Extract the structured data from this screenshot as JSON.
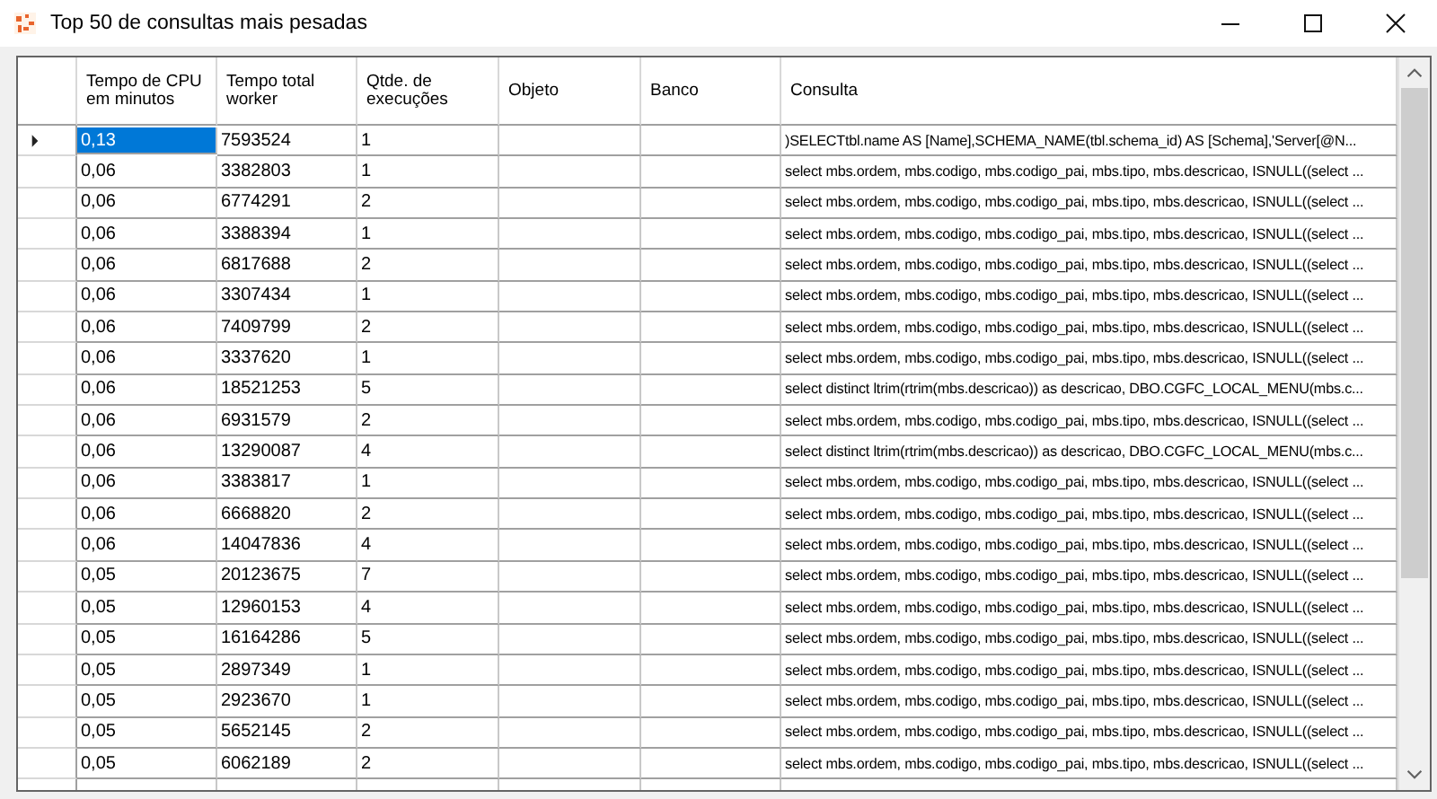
{
  "window": {
    "title": "Top 50 de consultas mais pesadas"
  },
  "table": {
    "columns": [
      "Tempo de CPU em minutos",
      "Tempo total worker",
      "Qtde. de execuções",
      "Objeto",
      "Banco",
      "Consulta"
    ],
    "rows": [
      {
        "selected": true,
        "cells": [
          "0,13",
          "7593524",
          "1",
          "",
          "",
          ")SELECTtbl.name AS [Name],SCHEMA_NAME(tbl.schema_id) AS [Schema],'Server[@N..."
        ]
      },
      {
        "selected": false,
        "cells": [
          "0,06",
          "3382803",
          "1",
          "",
          "",
          "select mbs.ordem, mbs.codigo, mbs.codigo_pai, mbs.tipo, mbs.descricao, ISNULL((select ..."
        ]
      },
      {
        "selected": false,
        "cells": [
          "0,06",
          "6774291",
          "2",
          "",
          "",
          "select mbs.ordem, mbs.codigo, mbs.codigo_pai, mbs.tipo, mbs.descricao, ISNULL((select ..."
        ]
      },
      {
        "selected": false,
        "cells": [
          "0,06",
          "3388394",
          "1",
          "",
          "",
          "select mbs.ordem, mbs.codigo, mbs.codigo_pai, mbs.tipo, mbs.descricao, ISNULL((select ..."
        ]
      },
      {
        "selected": false,
        "cells": [
          "0,06",
          "6817688",
          "2",
          "",
          "",
          "select mbs.ordem, mbs.codigo, mbs.codigo_pai, mbs.tipo, mbs.descricao, ISNULL((select ..."
        ]
      },
      {
        "selected": false,
        "cells": [
          "0,06",
          "3307434",
          "1",
          "",
          "",
          "select mbs.ordem, mbs.codigo, mbs.codigo_pai, mbs.tipo, mbs.descricao, ISNULL((select ..."
        ]
      },
      {
        "selected": false,
        "cells": [
          "0,06",
          "7409799",
          "2",
          "",
          "",
          "select mbs.ordem, mbs.codigo, mbs.codigo_pai, mbs.tipo, mbs.descricao, ISNULL((select ..."
        ]
      },
      {
        "selected": false,
        "cells": [
          "0,06",
          "3337620",
          "1",
          "",
          "",
          "select mbs.ordem, mbs.codigo, mbs.codigo_pai, mbs.tipo, mbs.descricao, ISNULL((select ..."
        ]
      },
      {
        "selected": false,
        "cells": [
          "0,06",
          "18521253",
          "5",
          "",
          "",
          "select  distinct ltrim(rtrim(mbs.descricao)) as descricao, DBO.CGFC_LOCAL_MENU(mbs.c..."
        ]
      },
      {
        "selected": false,
        "cells": [
          "0,06",
          "6931579",
          "2",
          "",
          "",
          "select mbs.ordem, mbs.codigo, mbs.codigo_pai, mbs.tipo, mbs.descricao, ISNULL((select ..."
        ]
      },
      {
        "selected": false,
        "cells": [
          "0,06",
          "13290087",
          "4",
          "",
          "",
          "select  distinct ltrim(rtrim(mbs.descricao)) as descricao, DBO.CGFC_LOCAL_MENU(mbs.c..."
        ]
      },
      {
        "selected": false,
        "cells": [
          "0,06",
          "3383817",
          "1",
          "",
          "",
          "select mbs.ordem, mbs.codigo, mbs.codigo_pai, mbs.tipo, mbs.descricao, ISNULL((select ..."
        ]
      },
      {
        "selected": false,
        "cells": [
          "0,06",
          "6668820",
          "2",
          "",
          "",
          "select mbs.ordem, mbs.codigo, mbs.codigo_pai, mbs.tipo, mbs.descricao, ISNULL((select ..."
        ]
      },
      {
        "selected": false,
        "cells": [
          "0,06",
          "14047836",
          "4",
          "",
          "",
          "select mbs.ordem, mbs.codigo, mbs.codigo_pai, mbs.tipo, mbs.descricao, ISNULL((select ..."
        ]
      },
      {
        "selected": false,
        "cells": [
          "0,05",
          "20123675",
          "7",
          "",
          "",
          "select mbs.ordem, mbs.codigo, mbs.codigo_pai, mbs.tipo, mbs.descricao, ISNULL((select ..."
        ]
      },
      {
        "selected": false,
        "cells": [
          "0,05",
          "12960153",
          "4",
          "",
          "",
          "select mbs.ordem, mbs.codigo, mbs.codigo_pai, mbs.tipo, mbs.descricao, ISNULL((select ..."
        ]
      },
      {
        "selected": false,
        "cells": [
          "0,05",
          "16164286",
          "5",
          "",
          "",
          "select mbs.ordem, mbs.codigo, mbs.codigo_pai, mbs.tipo, mbs.descricao, ISNULL((select ..."
        ]
      },
      {
        "selected": false,
        "cells": [
          "0,05",
          "2897349",
          "1",
          "",
          "",
          "select mbs.ordem, mbs.codigo, mbs.codigo_pai, mbs.tipo, mbs.descricao, ISNULL((select ..."
        ]
      },
      {
        "selected": false,
        "cells": [
          "0,05",
          "2923670",
          "1",
          "",
          "",
          "select mbs.ordem, mbs.codigo, mbs.codigo_pai, mbs.tipo, mbs.descricao, ISNULL((select ..."
        ]
      },
      {
        "selected": false,
        "cells": [
          "0,05",
          "5652145",
          "2",
          "",
          "",
          "select mbs.ordem, mbs.codigo, mbs.codigo_pai, mbs.tipo, mbs.descricao, ISNULL((select ..."
        ]
      },
      {
        "selected": false,
        "cells": [
          "0,05",
          "6062189",
          "2",
          "",
          "",
          "select mbs.ordem, mbs.codigo, mbs.codigo_pai, mbs.tipo, mbs.descricao, ISNULL((select ..."
        ]
      }
    ]
  }
}
